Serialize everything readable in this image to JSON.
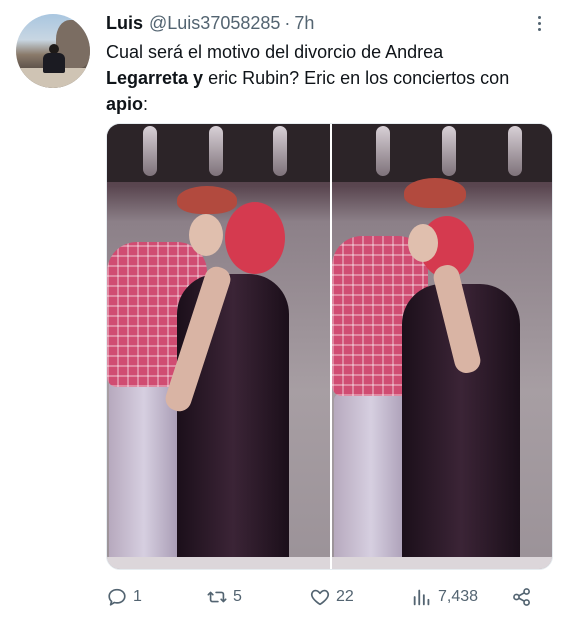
{
  "tweet": {
    "author_name": "Luis",
    "author_handle": "@Luis37058285",
    "separator": "·",
    "time": "7h",
    "text_lines": {
      "l1": "Cual será el motivo del divorcio de Andrea",
      "l2_bold": "Legarreta y",
      "l2_rest": " eric Rubin?  Eric en los conciertos con",
      "l3_bold": "apio",
      "l3_rest": ":"
    },
    "icons": {
      "more": "more-dots-icon",
      "reply": "reply-icon",
      "retweet": "retweet-icon",
      "like": "heart-icon",
      "views": "views-icon",
      "share": "share-icon"
    },
    "metrics": {
      "replies": "1",
      "retweets": "5",
      "likes": "22",
      "views": "7,438"
    },
    "colors": {
      "text": "#0f1419",
      "muted": "#536471"
    }
  }
}
